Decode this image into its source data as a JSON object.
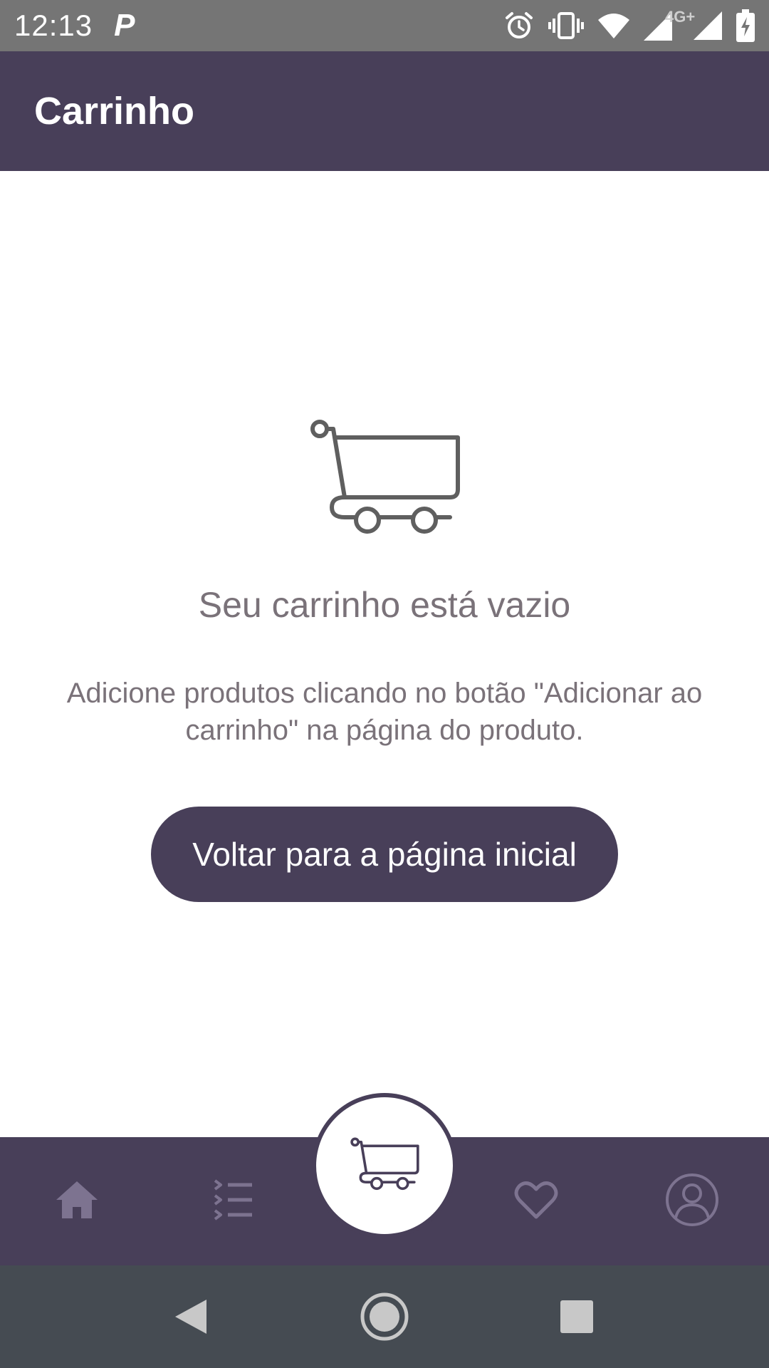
{
  "status_bar": {
    "time": "12:13",
    "notification_glyph": "P",
    "network_label": "4G+",
    "icons": [
      "alarm-icon",
      "vibrate-icon",
      "wifi-icon",
      "signal-icon",
      "signal-icon",
      "battery-charging-icon"
    ]
  },
  "app_bar": {
    "title": "Carrinho"
  },
  "empty_state": {
    "icon": "shopping-cart-icon",
    "title": "Seu carrinho está vazio",
    "description": "Adicione produtos clicando no botão \"Adicionar ao carrinho\" na página do produto.",
    "button_label": "Voltar para a página inicial"
  },
  "bottom_nav": {
    "items": [
      {
        "icon": "home-icon",
        "selected": false
      },
      {
        "icon": "list-icon",
        "selected": false
      },
      {
        "icon": "shopping-cart-icon",
        "selected": true
      },
      {
        "icon": "heart-icon",
        "selected": false
      },
      {
        "icon": "profile-icon",
        "selected": false
      }
    ]
  },
  "system_nav": {
    "buttons": [
      "back-icon",
      "home-circle-icon",
      "recents-icon"
    ]
  },
  "colors": {
    "primary": "#483F59",
    "status_bar": "#757575",
    "system_nav": "#454B52",
    "text_muted": "#7a7279",
    "icon_inactive": "#7d7390"
  }
}
